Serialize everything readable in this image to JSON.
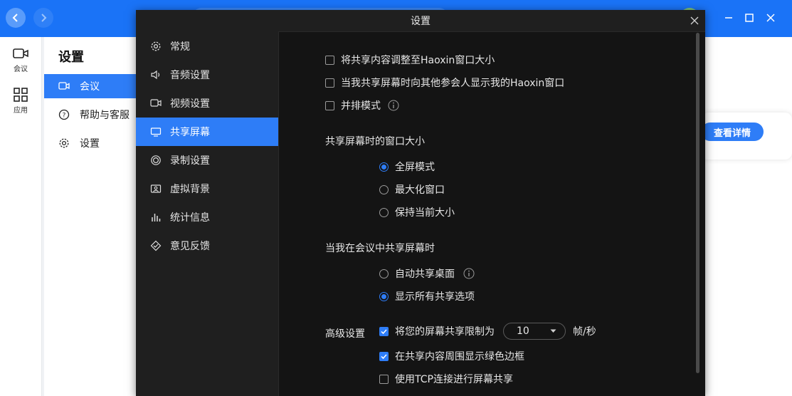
{
  "app": {
    "rail": [
      {
        "label": "会议"
      },
      {
        "label": "应用"
      }
    ]
  },
  "background": {
    "title": "设置",
    "nav": [
      {
        "label": "会议"
      },
      {
        "label": "帮助与客服"
      },
      {
        "label": "设置"
      }
    ],
    "detail_button": "查看详情"
  },
  "dialog": {
    "title": "设置",
    "nav": [
      {
        "label": "常规"
      },
      {
        "label": "音频设置"
      },
      {
        "label": "视频设置"
      },
      {
        "label": "共享屏幕"
      },
      {
        "label": "录制设置"
      },
      {
        "label": "虚拟背景"
      },
      {
        "label": "统计信息"
      },
      {
        "label": "意见反馈"
      }
    ],
    "options_top": [
      {
        "label": "将共享内容调整至Haoxin窗口大小",
        "checked": false
      },
      {
        "label": "当我共享屏幕时向其他参会人显示我的Haoxin窗口",
        "checked": false
      },
      {
        "label": "并排模式",
        "checked": false
      }
    ],
    "window_size": {
      "heading": "共享屏幕时的窗口大小",
      "options": [
        {
          "label": "全屏模式",
          "checked": true
        },
        {
          "label": "最大化窗口",
          "checked": false
        },
        {
          "label": "保持当前大小",
          "checked": false
        }
      ]
    },
    "when_sharing": {
      "heading": "当我在会议中共享屏幕时",
      "options": [
        {
          "label": "自动共享桌面",
          "checked": false
        },
        {
          "label": "显示所有共享选项",
          "checked": true
        }
      ]
    },
    "advanced": {
      "heading": "高级设置",
      "limit_label": "将您的屏幕共享限制为",
      "limit_value": "10",
      "limit_unit": "帧/秒",
      "green_border": "在共享内容周围显示绿色边框",
      "tcp": "使用TCP连接进行屏幕共享"
    }
  },
  "colors": {
    "accent": "#2e7df7",
    "topbar": "#1a73f7",
    "dialog_bg": "#141414",
    "sidebar_bg": "#1f1f1f"
  }
}
